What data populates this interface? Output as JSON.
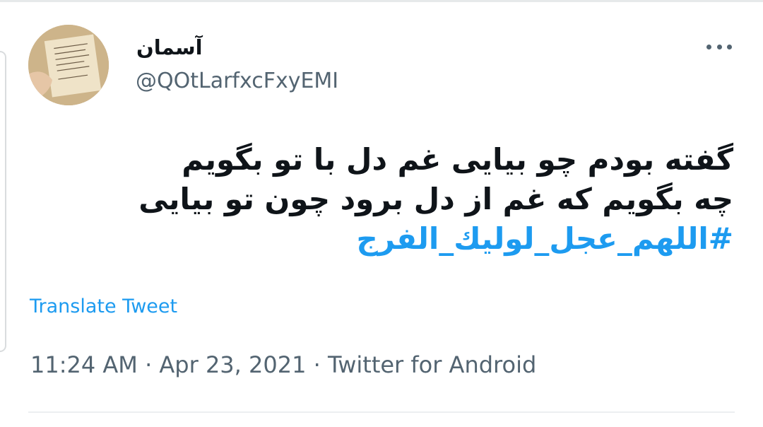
{
  "tweet": {
    "author": {
      "display_name": "آسمان",
      "handle": "@QOtLarfxcFxyEMI"
    },
    "text_lines": [
      "گفته بودم چو بیایی غم دل با تو بگویم",
      "چه بگویم که غم از دل برود چون تو بیایی"
    ],
    "hashtag": "#اللهم_عجل_لوليك_الفرج",
    "translate_label": "Translate Tweet",
    "time": "11:24 AM",
    "separator": "·",
    "date": "Apr 23, 2021",
    "source": "Twitter for Android"
  },
  "icons": {
    "more": "more-horizontal-icon"
  },
  "colors": {
    "link": "#1d9bf0",
    "text": "#0f1419",
    "secondary": "#536471"
  }
}
